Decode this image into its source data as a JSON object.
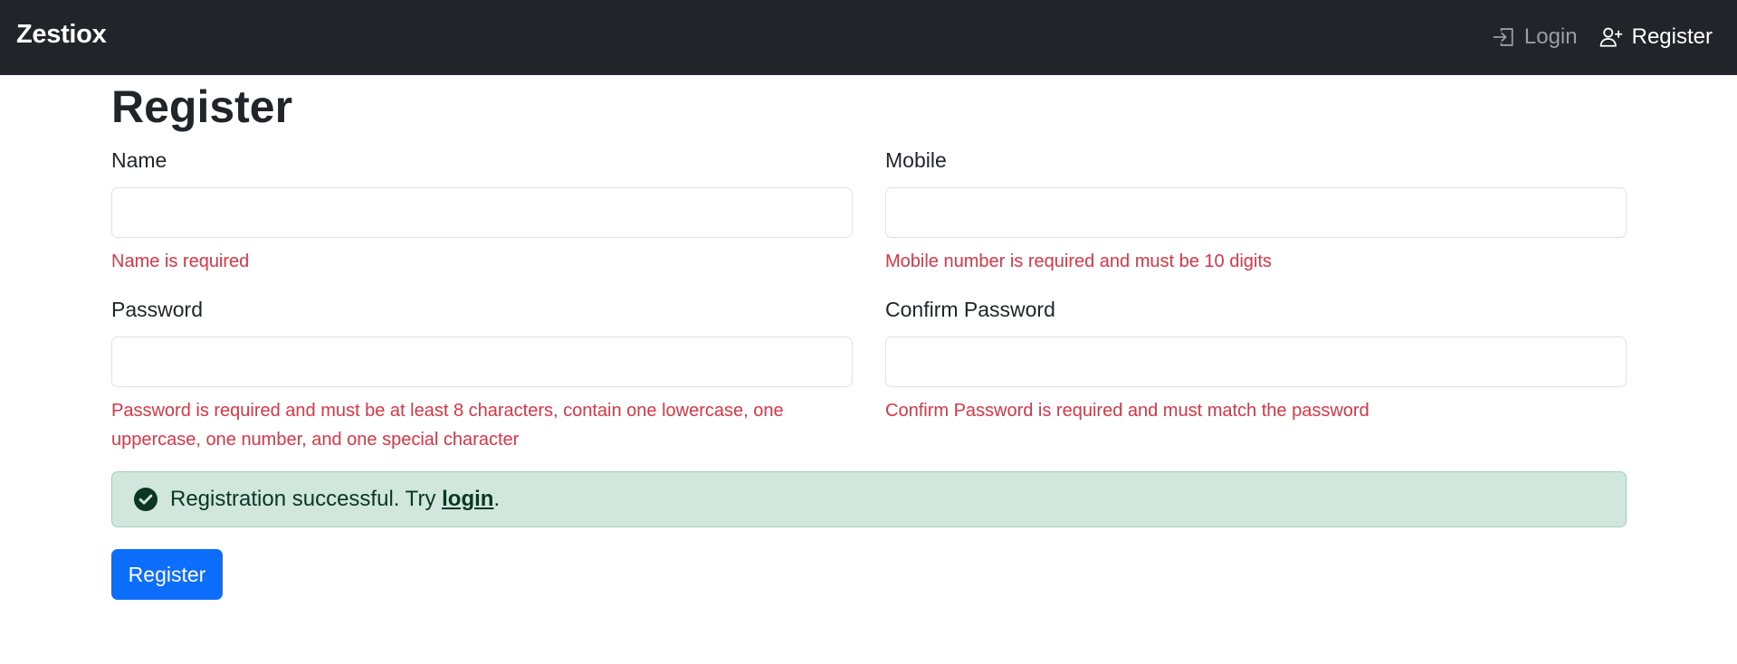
{
  "navbar": {
    "brand": "Zestiox",
    "links": [
      {
        "label": "Login",
        "icon": "login-icon"
      },
      {
        "label": "Register",
        "icon": "person-plus-icon"
      }
    ]
  },
  "page": {
    "title": "Register"
  },
  "form": {
    "name": {
      "label": "Name",
      "value": "",
      "error": "Name is required"
    },
    "mobile": {
      "label": "Mobile",
      "value": "",
      "error": "Mobile number is required and must be 10 digits"
    },
    "password": {
      "label": "Password",
      "value": "",
      "error": "Password is required and must be at least 8 characters, contain one lowercase, one uppercase, one number, and one special character"
    },
    "confirm_password": {
      "label": "Confirm Password",
      "value": "",
      "error": "Confirm Password is required and must match the password"
    }
  },
  "alert": {
    "text_before": "Registration successful. Try ",
    "link_label": "login",
    "text_after": ".",
    "icon": "check-circle-icon",
    "color": "#d1e7dd"
  },
  "submit": {
    "label": "Register",
    "color": "#0d6efd"
  }
}
